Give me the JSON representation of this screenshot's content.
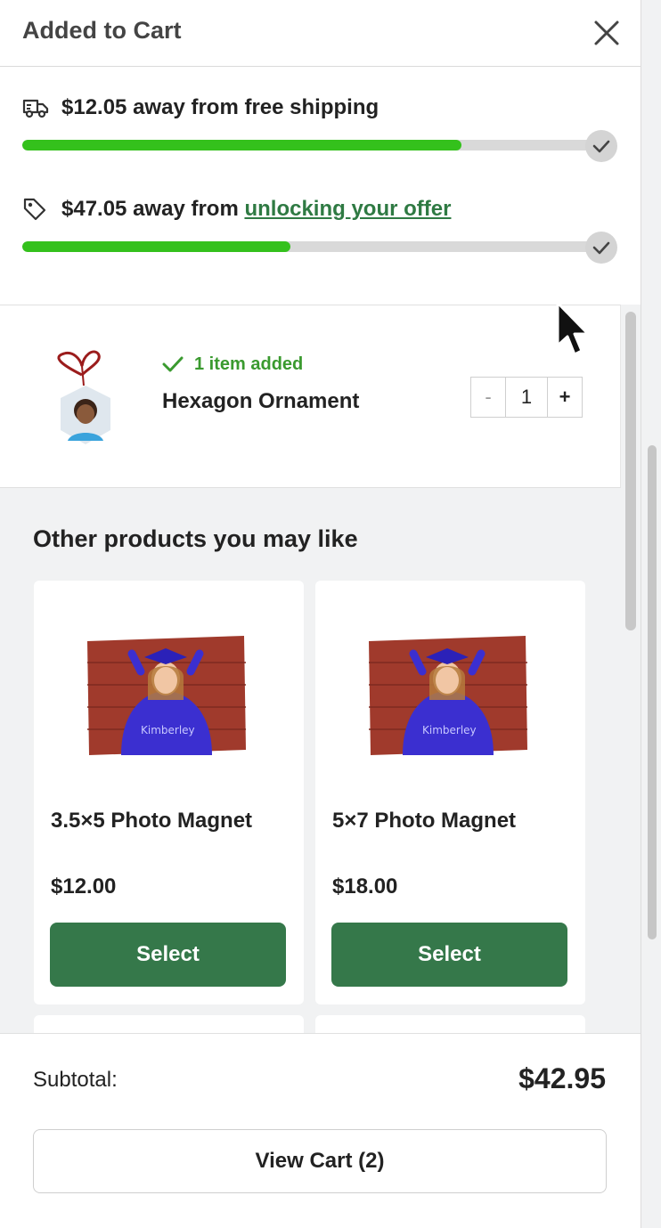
{
  "header": {
    "title": "Added to Cart",
    "close_icon": "close-icon"
  },
  "shipping": {
    "icon": "truck-icon",
    "amount": "$12.05",
    "text": " away from free shipping",
    "progress": 0.77
  },
  "offer": {
    "icon": "tag-icon",
    "amount": "$47.05",
    "text": " away from ",
    "link": "unlocking your offer",
    "progress": 0.47
  },
  "added_item": {
    "status": "1 item added",
    "name": "Hexagon Ornament",
    "quantity": "1",
    "minus": "-",
    "plus": "+"
  },
  "recommendations": {
    "title": "Other products you may like",
    "products": [
      {
        "name": "3.5×5 Photo Magnet",
        "price": "$12.00",
        "button": "Select"
      },
      {
        "name": "5×7 Photo Magnet",
        "price": "$18.00",
        "button": "Select"
      }
    ]
  },
  "footer": {
    "subtotal_label": "Subtotal:",
    "subtotal_value": "$42.95",
    "view_cart": "View Cart (2)"
  },
  "colors": {
    "progress_green": "#34c11c",
    "button_green": "#35784a",
    "link_green": "#2f7a43",
    "added_green": "#3a9a2f"
  }
}
